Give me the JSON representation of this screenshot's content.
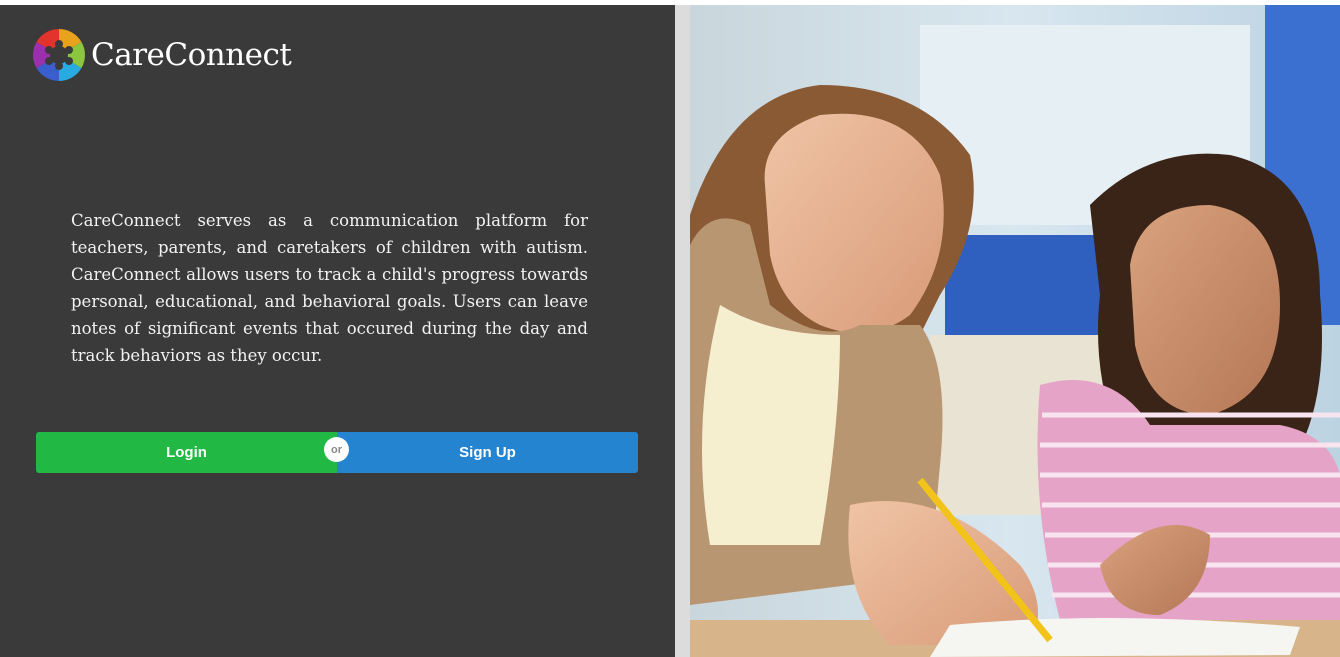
{
  "app": {
    "name": "CareConnect"
  },
  "intro": {
    "text": "CareConnect serves as a communication platform for teachers, parents, and caretakers of children with autism. CareConnect allows users to track a child's progress towards personal, educational, and behavioral goals. Users can leave notes of significant events that occured during the day and track behaviors as they occur."
  },
  "actions": {
    "login_label": "Login",
    "separator": "or",
    "signup_label": "Sign Up"
  },
  "colors": {
    "panel_bg": "#3a3a3a",
    "login": "#22b844",
    "signup": "#2584d0"
  },
  "icons": {
    "logo": "puzzle-circle-logo-icon"
  }
}
